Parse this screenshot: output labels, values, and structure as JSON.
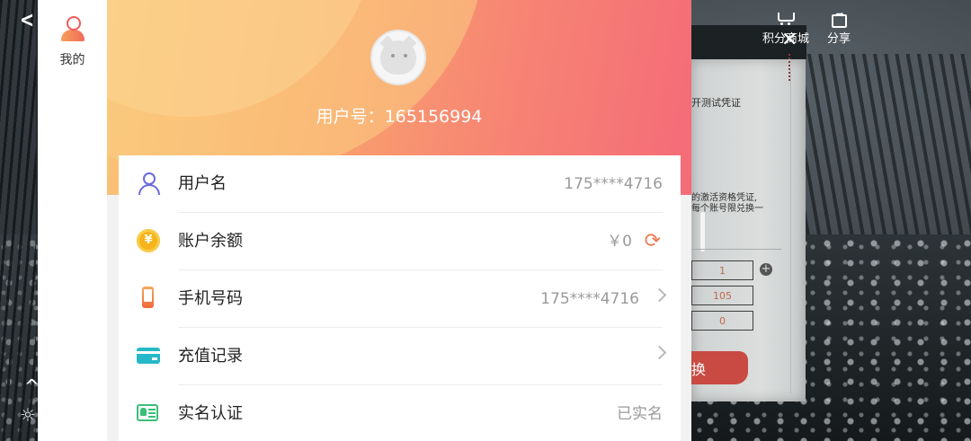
{
  "game": {
    "top_actions": [
      {
        "icon": "cart-icon",
        "label": "积分商城"
      },
      {
        "icon": "share-icon",
        "label": "分享"
      }
    ],
    "panel": {
      "title": "开测试凭证",
      "description": "的激活资格凭证,\n每个账号限兑换一",
      "qty_values": [
        "1",
        "105",
        "0"
      ],
      "button_label": "换"
    }
  },
  "sidebar": {
    "me_label": "我的",
    "me_icon": "user-profile-icon"
  },
  "header": {
    "user_id": "用户号：165156994",
    "avatar_icon": "cat-avatar-icon"
  },
  "rows": [
    {
      "icon": "user-icon",
      "label": "用户名",
      "value": "175****4716"
    },
    {
      "icon": "coin-icon",
      "label": "账户余额",
      "value": "￥0",
      "coin_glyph": "¥"
    },
    {
      "icon": "phone-icon",
      "label": "手机号码",
      "value": "175****4716"
    },
    {
      "icon": "card-icon",
      "label": "充值记录",
      "value": ""
    },
    {
      "icon": "id-card-icon",
      "label": "实名认证",
      "value": "已实名"
    }
  ],
  "colors": {
    "header_gradient_start": "#f9c677",
    "header_gradient_end": "#f46b78",
    "accent_orange": "#f07a52"
  }
}
